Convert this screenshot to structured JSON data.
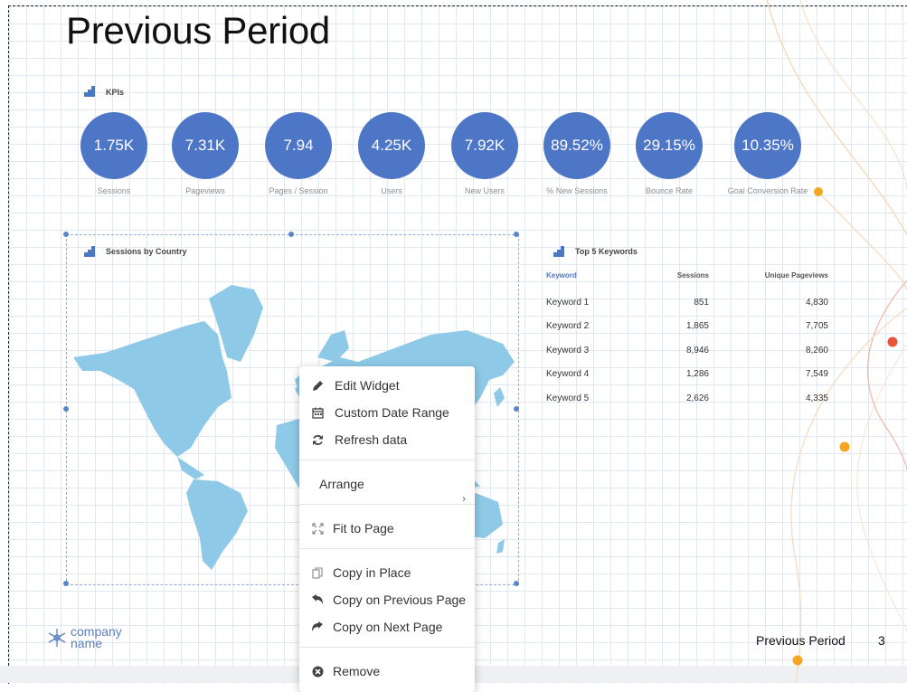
{
  "title": "Previous Period",
  "kpis": {
    "label": "KPIs",
    "items": [
      {
        "value": "1.75K",
        "label": "Sessions"
      },
      {
        "value": "7.31K",
        "label": "Pageviews"
      },
      {
        "value": "7.94",
        "label": "Pages / Session"
      },
      {
        "value": "4.25K",
        "label": "Users"
      },
      {
        "value": "7.92K",
        "label": "New Users"
      },
      {
        "value": "89.52%",
        "label": "% New Sessions"
      },
      {
        "value": "29.15%",
        "label": "Bounce Rate"
      },
      {
        "value": "10.35%",
        "label": "Goal Conversion Rate"
      }
    ]
  },
  "map_widget": {
    "label": "Sessions by Country",
    "map_color": "#8ecae8"
  },
  "keywords": {
    "label": "Top 5 Keywords",
    "columns": [
      "Keyword",
      "Sessions",
      "Unique Pageviews"
    ],
    "rows": [
      [
        "Keyword 1",
        "851",
        "4,830"
      ],
      [
        "Keyword 2",
        "1,865",
        "7,705"
      ],
      [
        "Keyword 3",
        "8,946",
        "8,260"
      ],
      [
        "Keyword 4",
        "1,286",
        "7,549"
      ],
      [
        "Keyword 5",
        "2,626",
        "4,335"
      ]
    ]
  },
  "context_menu": {
    "edit_widget": "Edit Widget",
    "custom_date_range": "Custom Date Range",
    "refresh_data": "Refresh data",
    "arrange": "Arrange",
    "fit_to_page": "Fit to Page",
    "copy_in_place": "Copy in Place",
    "copy_on_previous_page": "Copy on Previous Page",
    "copy_on_next_page": "Copy on Next Page",
    "remove": "Remove"
  },
  "footer": {
    "logo_line1": "company",
    "logo_line2": "name",
    "page_title": "Previous Period",
    "page_number": "3"
  },
  "colors": {
    "accent": "#4e76c6",
    "dot_orange": "#f5a623",
    "dot_red": "#e8553a"
  }
}
